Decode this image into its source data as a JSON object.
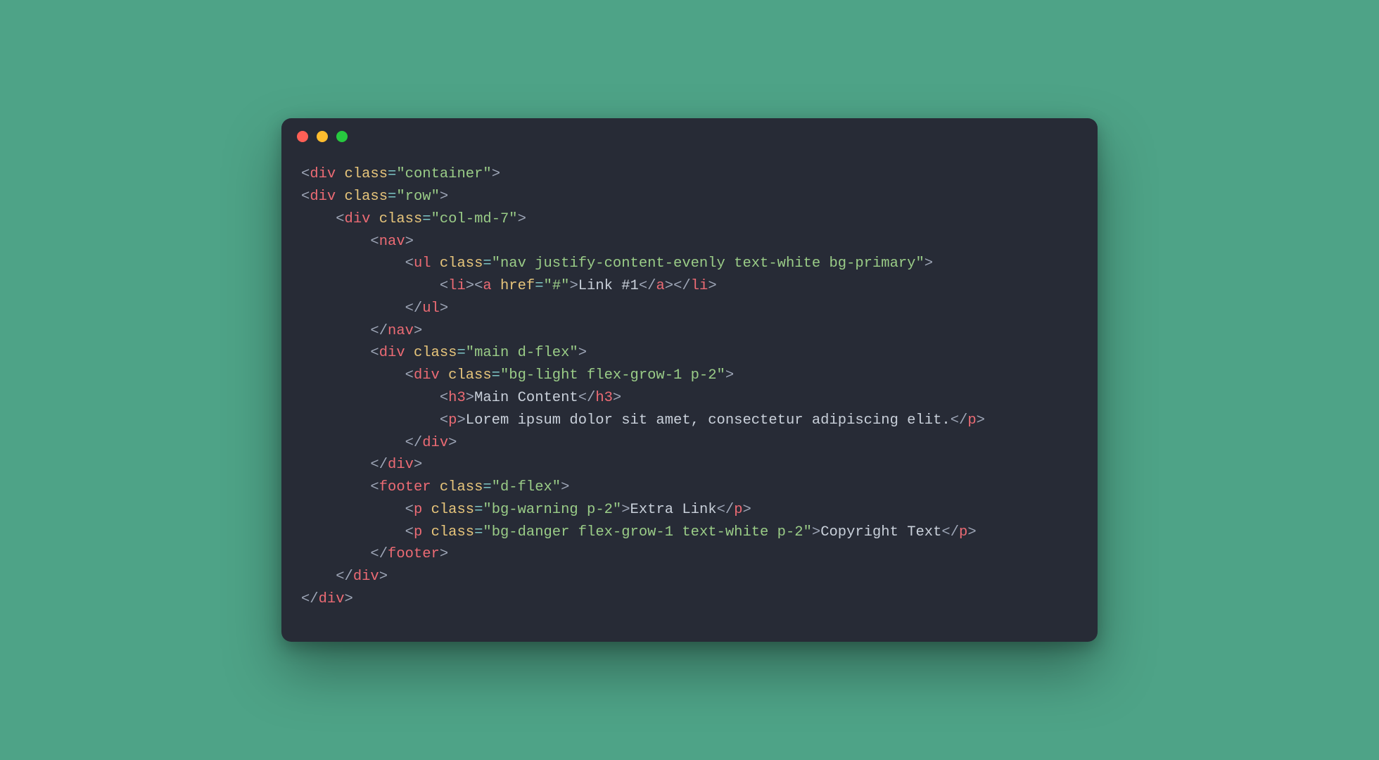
{
  "colors": {
    "page_bg": "#4ea387",
    "window_bg": "#272b36",
    "dot_red": "#ff5f56",
    "dot_yellow": "#ffbd2e",
    "dot_green": "#27c93f",
    "bracket": "#9fa7b8",
    "tag": "#ec6b74",
    "attr": "#e7c57b",
    "equals": "#7dc4c4",
    "string": "#9acc87",
    "text": "#c9d0da"
  },
  "dots": [
    "red",
    "yellow",
    "green"
  ],
  "code": {
    "lines": [
      {
        "indent": 0,
        "tokens": [
          {
            "t": "br",
            "v": "<"
          },
          {
            "t": "tag",
            "v": "div"
          },
          {
            "t": "br",
            "v": " "
          },
          {
            "t": "att",
            "v": "class"
          },
          {
            "t": "eq",
            "v": "="
          },
          {
            "t": "str",
            "v": "\"container\""
          },
          {
            "t": "br",
            "v": ">"
          }
        ]
      },
      {
        "indent": 0,
        "tokens": [
          {
            "t": "br",
            "v": "<"
          },
          {
            "t": "tag",
            "v": "div"
          },
          {
            "t": "br",
            "v": " "
          },
          {
            "t": "att",
            "v": "class"
          },
          {
            "t": "eq",
            "v": "="
          },
          {
            "t": "str",
            "v": "\"row\""
          },
          {
            "t": "br",
            "v": ">"
          }
        ]
      },
      {
        "indent": 4,
        "tokens": [
          {
            "t": "br",
            "v": "<"
          },
          {
            "t": "tag",
            "v": "div"
          },
          {
            "t": "br",
            "v": " "
          },
          {
            "t": "att",
            "v": "class"
          },
          {
            "t": "eq",
            "v": "="
          },
          {
            "t": "str",
            "v": "\"col-md-7\""
          },
          {
            "t": "br",
            "v": ">"
          }
        ]
      },
      {
        "indent": 8,
        "tokens": [
          {
            "t": "br",
            "v": "<"
          },
          {
            "t": "tag",
            "v": "nav"
          },
          {
            "t": "br",
            "v": ">"
          }
        ]
      },
      {
        "indent": 12,
        "tokens": [
          {
            "t": "br",
            "v": "<"
          },
          {
            "t": "tag",
            "v": "ul"
          },
          {
            "t": "br",
            "v": " "
          },
          {
            "t": "att",
            "v": "class"
          },
          {
            "t": "eq",
            "v": "="
          },
          {
            "t": "str",
            "v": "\"nav justify-content-evenly text-white bg-primary\""
          },
          {
            "t": "br",
            "v": ">"
          }
        ]
      },
      {
        "indent": 16,
        "tokens": [
          {
            "t": "br",
            "v": "<"
          },
          {
            "t": "tag",
            "v": "li"
          },
          {
            "t": "br",
            "v": "><"
          },
          {
            "t": "tag",
            "v": "a"
          },
          {
            "t": "br",
            "v": " "
          },
          {
            "t": "att",
            "v": "href"
          },
          {
            "t": "eq",
            "v": "="
          },
          {
            "t": "str",
            "v": "\"#\""
          },
          {
            "t": "br",
            "v": ">"
          },
          {
            "t": "txt",
            "v": "Link #1"
          },
          {
            "t": "br",
            "v": "</"
          },
          {
            "t": "tag",
            "v": "a"
          },
          {
            "t": "br",
            "v": "></"
          },
          {
            "t": "tag",
            "v": "li"
          },
          {
            "t": "br",
            "v": ">"
          }
        ]
      },
      {
        "indent": 12,
        "tokens": [
          {
            "t": "br",
            "v": "</"
          },
          {
            "t": "tag",
            "v": "ul"
          },
          {
            "t": "br",
            "v": ">"
          }
        ]
      },
      {
        "indent": 8,
        "tokens": [
          {
            "t": "br",
            "v": "</"
          },
          {
            "t": "tag",
            "v": "nav"
          },
          {
            "t": "br",
            "v": ">"
          }
        ]
      },
      {
        "indent": 8,
        "tokens": [
          {
            "t": "br",
            "v": "<"
          },
          {
            "t": "tag",
            "v": "div"
          },
          {
            "t": "br",
            "v": " "
          },
          {
            "t": "att",
            "v": "class"
          },
          {
            "t": "eq",
            "v": "="
          },
          {
            "t": "str",
            "v": "\"main d-flex\""
          },
          {
            "t": "br",
            "v": ">"
          }
        ]
      },
      {
        "indent": 12,
        "tokens": [
          {
            "t": "br",
            "v": "<"
          },
          {
            "t": "tag",
            "v": "div"
          },
          {
            "t": "br",
            "v": " "
          },
          {
            "t": "att",
            "v": "class"
          },
          {
            "t": "eq",
            "v": "="
          },
          {
            "t": "str",
            "v": "\"bg-light flex-grow-1 p-2\""
          },
          {
            "t": "br",
            "v": ">"
          }
        ]
      },
      {
        "indent": 16,
        "tokens": [
          {
            "t": "br",
            "v": "<"
          },
          {
            "t": "tag",
            "v": "h3"
          },
          {
            "t": "br",
            "v": ">"
          },
          {
            "t": "txt",
            "v": "Main Content"
          },
          {
            "t": "br",
            "v": "</"
          },
          {
            "t": "tag",
            "v": "h3"
          },
          {
            "t": "br",
            "v": ">"
          }
        ]
      },
      {
        "indent": 16,
        "tokens": [
          {
            "t": "br",
            "v": "<"
          },
          {
            "t": "tag",
            "v": "p"
          },
          {
            "t": "br",
            "v": ">"
          },
          {
            "t": "txt",
            "v": "Lorem ipsum dolor sit amet, consectetur adipiscing elit."
          },
          {
            "t": "br",
            "v": "</"
          },
          {
            "t": "tag",
            "v": "p"
          },
          {
            "t": "br",
            "v": ">"
          }
        ]
      },
      {
        "indent": 12,
        "tokens": [
          {
            "t": "br",
            "v": "</"
          },
          {
            "t": "tag",
            "v": "div"
          },
          {
            "t": "br",
            "v": ">"
          }
        ]
      },
      {
        "indent": 8,
        "tokens": [
          {
            "t": "br",
            "v": "</"
          },
          {
            "t": "tag",
            "v": "div"
          },
          {
            "t": "br",
            "v": ">"
          }
        ]
      },
      {
        "indent": 8,
        "tokens": [
          {
            "t": "br",
            "v": "<"
          },
          {
            "t": "tag",
            "v": "footer"
          },
          {
            "t": "br",
            "v": " "
          },
          {
            "t": "att",
            "v": "class"
          },
          {
            "t": "eq",
            "v": "="
          },
          {
            "t": "str",
            "v": "\"d-flex\""
          },
          {
            "t": "br",
            "v": ">"
          }
        ]
      },
      {
        "indent": 12,
        "tokens": [
          {
            "t": "br",
            "v": "<"
          },
          {
            "t": "tag",
            "v": "p"
          },
          {
            "t": "br",
            "v": " "
          },
          {
            "t": "att",
            "v": "class"
          },
          {
            "t": "eq",
            "v": "="
          },
          {
            "t": "str",
            "v": "\"bg-warning p-2\""
          },
          {
            "t": "br",
            "v": ">"
          },
          {
            "t": "txt",
            "v": "Extra Link"
          },
          {
            "t": "br",
            "v": "</"
          },
          {
            "t": "tag",
            "v": "p"
          },
          {
            "t": "br",
            "v": ">"
          }
        ]
      },
      {
        "indent": 12,
        "tokens": [
          {
            "t": "br",
            "v": "<"
          },
          {
            "t": "tag",
            "v": "p"
          },
          {
            "t": "br",
            "v": " "
          },
          {
            "t": "att",
            "v": "class"
          },
          {
            "t": "eq",
            "v": "="
          },
          {
            "t": "str",
            "v": "\"bg-danger flex-grow-1 text-white p-2\""
          },
          {
            "t": "br",
            "v": ">"
          },
          {
            "t": "txt",
            "v": "Copyright Text"
          },
          {
            "t": "br",
            "v": "</"
          },
          {
            "t": "tag",
            "v": "p"
          },
          {
            "t": "br",
            "v": ">"
          }
        ]
      },
      {
        "indent": 8,
        "tokens": [
          {
            "t": "br",
            "v": "</"
          },
          {
            "t": "tag",
            "v": "footer"
          },
          {
            "t": "br",
            "v": ">"
          }
        ]
      },
      {
        "indent": 4,
        "tokens": [
          {
            "t": "br",
            "v": "</"
          },
          {
            "t": "tag",
            "v": "div"
          },
          {
            "t": "br",
            "v": ">"
          }
        ]
      },
      {
        "indent": 0,
        "tokens": [
          {
            "t": "br",
            "v": "</"
          },
          {
            "t": "tag",
            "v": "div"
          },
          {
            "t": "br",
            "v": ">"
          }
        ]
      }
    ]
  }
}
